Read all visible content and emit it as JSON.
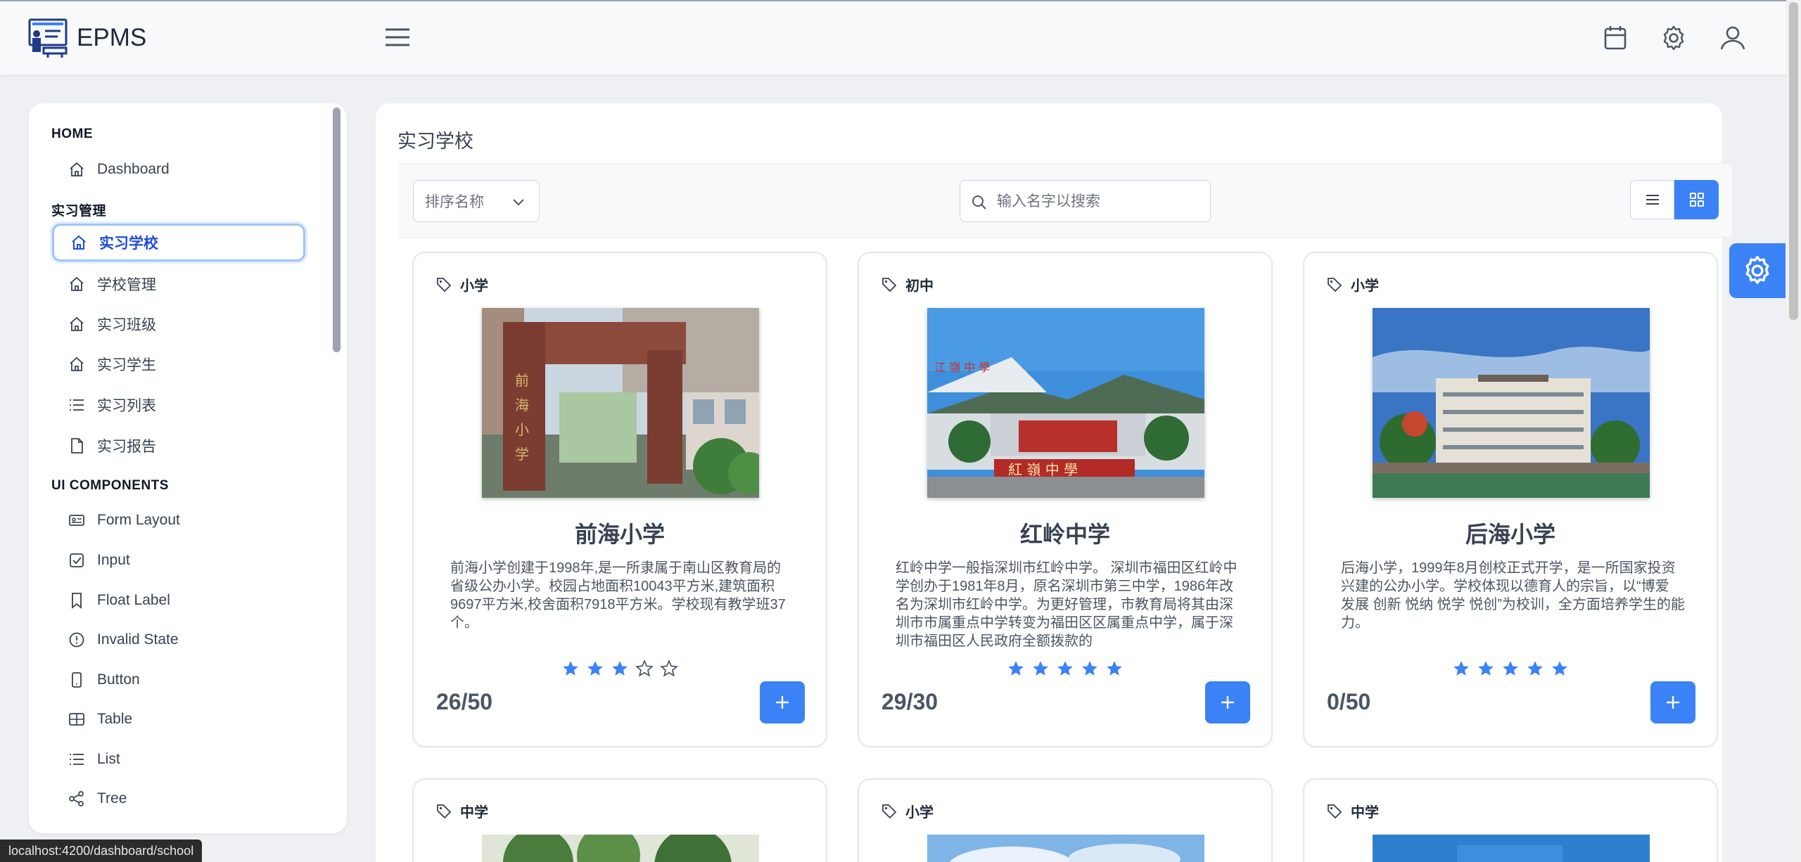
{
  "app": {
    "name": "EPMS"
  },
  "sidebar": {
    "sections": [
      {
        "title": "HOME",
        "items": [
          {
            "label": "Dashboard",
            "icon": "home-icon"
          }
        ]
      },
      {
        "title": "实习管理",
        "items": [
          {
            "label": "实习学校",
            "icon": "home-icon",
            "active": true
          },
          {
            "label": "学校管理",
            "icon": "home-icon"
          },
          {
            "label": "实习班级",
            "icon": "home-icon"
          },
          {
            "label": "实习学生",
            "icon": "home-icon"
          },
          {
            "label": "实习列表",
            "icon": "list-icon"
          },
          {
            "label": "实习报告",
            "icon": "file-icon"
          }
        ]
      },
      {
        "title": "UI COMPONENTS",
        "items": [
          {
            "label": "Form Layout",
            "icon": "id-card-icon"
          },
          {
            "label": "Input",
            "icon": "check-square-icon"
          },
          {
            "label": "Float Label",
            "icon": "bookmark-icon"
          },
          {
            "label": "Invalid State",
            "icon": "exclamation-circle-icon"
          },
          {
            "label": "Button",
            "icon": "mobile-icon"
          },
          {
            "label": "Table",
            "icon": "table-icon"
          },
          {
            "label": "List",
            "icon": "list-icon"
          },
          {
            "label": "Tree",
            "icon": "share-icon"
          }
        ]
      }
    ]
  },
  "main": {
    "title": "实习学校",
    "sort": {
      "placeholder": "排序名称"
    },
    "search": {
      "placeholder": "输入名字以搜索"
    }
  },
  "cards": [
    {
      "tag": "小学",
      "name": "前海小学",
      "description": "前海小学创建于1998年,是一所隶属于南山区教育局的省级公办小学。校园占地面积10043平方米,建筑面积9697平方米,校舍面积7918平方米。学校现有教学班37个。",
      "rating": 3,
      "max_rating": 5,
      "count": "26/50",
      "image": "school-gate-photo"
    },
    {
      "tag": "初中",
      "name": "红岭中学",
      "description": "红岭中学一般指深圳市红岭中学。 深圳市福田区红岭中学创办于1981年8月，原名深圳市第三中学，1986年改名为深圳市红岭中学。为更好管理，市教育局将其由深圳市市属重点中学转变为福田区区属重点中学，属于深圳市福田区人民政府全额拨款的",
      "rating": 5,
      "max_rating": 5,
      "count": "29/30",
      "image": "school-building-photo"
    },
    {
      "tag": "小学",
      "name": "后海小学",
      "description": "后海小学，1999年8月创校正式开学，是一所国家投资兴建的公办小学。学校体现以德育人的宗旨，以“博爱 发展 创新 悦纳 悦学 悦创”为校训，全方面培养学生的能力。",
      "rating": 5,
      "max_rating": 5,
      "count": "0/50",
      "image": "school-building-photo"
    },
    {
      "tag": "中学",
      "image": "school-trees-photo"
    },
    {
      "tag": "小学",
      "image": "sky-photo"
    },
    {
      "tag": "中学",
      "image": "school-sign-photo"
    }
  ],
  "status_bar": {
    "url": "localhost:4200/dashboard/school"
  },
  "colors": {
    "primary": "#3b82f6",
    "star": "#3b82f6"
  }
}
